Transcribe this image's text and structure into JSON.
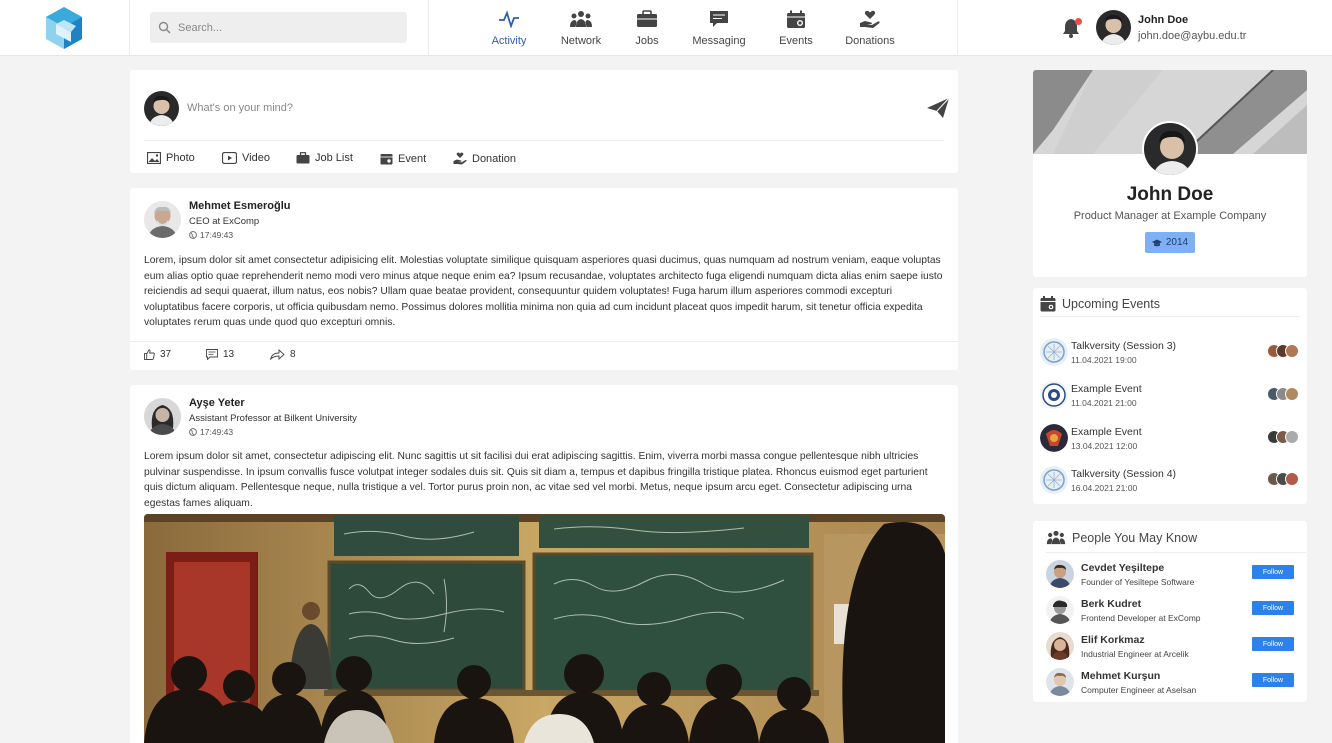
{
  "header": {
    "search_placeholder": "Search...",
    "nav": [
      {
        "label": "Activity",
        "icon": "activity-icon",
        "active": true
      },
      {
        "label": "Network",
        "icon": "network-icon"
      },
      {
        "label": "Jobs",
        "icon": "briefcase-icon"
      },
      {
        "label": "Messaging",
        "icon": "message-icon"
      },
      {
        "label": "Events",
        "icon": "calendar-icon"
      },
      {
        "label": "Donations",
        "icon": "donation-icon"
      }
    ],
    "user": {
      "name": "John Doe",
      "email": "john.doe@aybu.edu.tr"
    },
    "accent_color": "#2f5fa8"
  },
  "composer": {
    "placeholder": "What's on your mind?",
    "actions": [
      {
        "label": "Photo",
        "icon": "photo-icon"
      },
      {
        "label": "Video",
        "icon": "video-icon"
      },
      {
        "label": "Job List",
        "icon": "briefcase-icon"
      },
      {
        "label": "Event",
        "icon": "calendar-icon"
      },
      {
        "label": "Donation",
        "icon": "donation-icon"
      }
    ]
  },
  "posts": [
    {
      "author": "Mehmet Esmeroğlu",
      "role": "CEO at ExComp",
      "time": "17:49:43",
      "body": "Lorem, ipsum dolor sit amet consectetur adipisicing elit. Molestias voluptate similique quisquam asperiores quasi ducimus, quas numquam ad nostrum veniam, eaque voluptas eum alias optio quae reprehenderit nemo modi vero minus atque neque enim ea? Ipsum recusandae, voluptates architecto fuga eligendi numquam dicta alias enim saepe iusto reiciendis ad sequi quaerat, illum natus, eos nobis? Ullam quae beatae provident, consequuntur quidem voluptates! Fuga harum illum asperiores commodi excepturi voluptatibus facere corporis, ut officia quibusdam nemo. Possimus dolores mollitia minima non quia ad cum incidunt placeat quos impedit harum, sit tenetur officia expedita voluptates rerum quas unde quod quo excepturi omnis.",
      "likes": "37",
      "comments": "13",
      "shares": "8"
    },
    {
      "author": "Ayşe Yeter",
      "role": "Assistant Professor at Bilkent University",
      "time": "17:49:43",
      "body": "Lorem ipsum dolor sit amet, consectetur adipiscing elit. Nunc sagittis ut sit facilisi dui erat adipiscing sagittis. Enim, viverra morbi massa congue pellentesque nibh ultricies pulvinar suspendisse. In ipsum convallis fusce volutpat integer sodales duis sit. Quis sit diam a, tempus et dapibus fringilla tristique platea. Rhoncus euismod eget parturient quis dictum aliquam. Pellentesque neque, nulla tristique a vel. Tortor purus proin non, ac vitae sed vel morbi. Metus, neque ipsum arcu eget. Consectetur adipiscing urna egestas fames aliquam."
    }
  ],
  "profile": {
    "name": "John Doe",
    "title": "Product Manager at Example Company",
    "year": "2014"
  },
  "events": {
    "heading": "Upcoming Events",
    "items": [
      {
        "title": "Talkversity (Session 3)",
        "date": "11.04.2021 19:00"
      },
      {
        "title": "Example Event",
        "date": "11.04.2021 21:00"
      },
      {
        "title": "Example Event",
        "date": "13.04.2021 12:00"
      },
      {
        "title": "Talkversity (Session 4)",
        "date": "16.04.2021 21:00"
      }
    ]
  },
  "people": {
    "heading": "People You May Know",
    "follow_label": "Follow",
    "items": [
      {
        "name": "Cevdet Yeşiltepe",
        "role": "Founder of Yesiltepe Software"
      },
      {
        "name": "Berk Kudret",
        "role": "Frontend Developer at ExComp"
      },
      {
        "name": "Elif Korkmaz",
        "role": "Industrial Engineer at Arcelik"
      },
      {
        "name": "Mehmet Kurşun",
        "role": "Computer Engineer at Aselsan"
      }
    ]
  }
}
